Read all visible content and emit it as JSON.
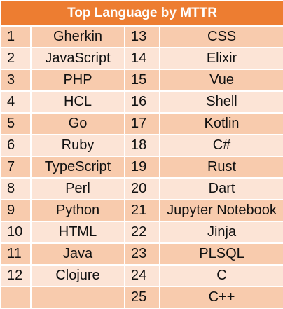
{
  "title": "Top Language by MTTR",
  "rows": [
    {
      "rank_a": "1",
      "lang_a": "Gherkin",
      "rank_b": "13",
      "lang_b": "CSS"
    },
    {
      "rank_a": "2",
      "lang_a": "JavaScript",
      "rank_b": "14",
      "lang_b": "Elixir"
    },
    {
      "rank_a": "3",
      "lang_a": "PHP",
      "rank_b": "15",
      "lang_b": "Vue"
    },
    {
      "rank_a": "4",
      "lang_a": "HCL",
      "rank_b": "16",
      "lang_b": "Shell"
    },
    {
      "rank_a": "5",
      "lang_a": "Go",
      "rank_b": "17",
      "lang_b": "Kotlin"
    },
    {
      "rank_a": "6",
      "lang_a": "Ruby",
      "rank_b": "18",
      "lang_b": "C#"
    },
    {
      "rank_a": "7",
      "lang_a": "TypeScript",
      "rank_b": "19",
      "lang_b": "Rust"
    },
    {
      "rank_a": "8",
      "lang_a": "Perl",
      "rank_b": "20",
      "lang_b": "Dart"
    },
    {
      "rank_a": "9",
      "lang_a": "Python",
      "rank_b": "21",
      "lang_b": "Jupyter Notebook"
    },
    {
      "rank_a": "10",
      "lang_a": "HTML",
      "rank_b": "22",
      "lang_b": "Jinja"
    },
    {
      "rank_a": "11",
      "lang_a": "Java",
      "rank_b": "23",
      "lang_b": "PLSQL"
    },
    {
      "rank_a": "12",
      "lang_a": "Clojure",
      "rank_b": "24",
      "lang_b": "C"
    },
    {
      "rank_a": "",
      "lang_a": "",
      "rank_b": "25",
      "lang_b": "C++"
    }
  ],
  "colors": {
    "header": "#ed7d31",
    "band_dark": "#f8cbad",
    "band_light": "#fce4d6",
    "border": "#ffffff"
  }
}
